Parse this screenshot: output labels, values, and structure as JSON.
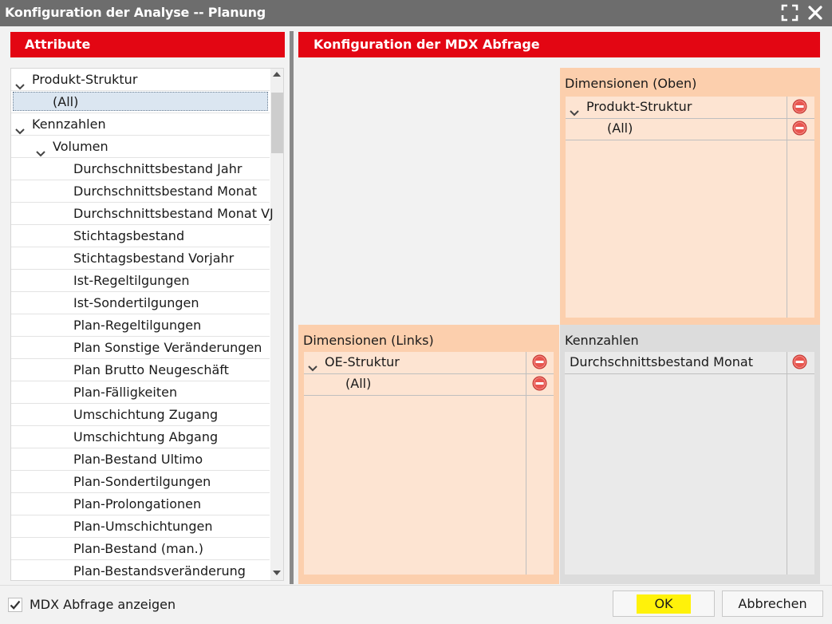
{
  "window": {
    "title": "Konfiguration der Analyse -- Planung"
  },
  "left_panel": {
    "header": "Attribute",
    "tree": [
      {
        "label": "Produkt-Struktur",
        "level": 0,
        "expanded": true
      },
      {
        "label": "(All)",
        "level": 1,
        "selected": true
      },
      {
        "label": "Kennzahlen",
        "level": 0,
        "expanded": true
      },
      {
        "label": "Volumen",
        "level": 1,
        "expanded": true
      },
      {
        "label": "Durchschnittsbestand Jahr",
        "level": 2
      },
      {
        "label": "Durchschnittsbestand Monat",
        "level": 2
      },
      {
        "label": "Durchschnittsbestand Monat VJ",
        "level": 2
      },
      {
        "label": "Stichtagsbestand",
        "level": 2
      },
      {
        "label": "Stichtagsbestand Vorjahr",
        "level": 2
      },
      {
        "label": "Ist-Regeltilgungen",
        "level": 2
      },
      {
        "label": "Ist-Sondertilgungen",
        "level": 2
      },
      {
        "label": "Plan-Regeltilgungen",
        "level": 2
      },
      {
        "label": "Plan Sonstige Veränderungen",
        "level": 2
      },
      {
        "label": "Plan Brutto Neugeschäft",
        "level": 2
      },
      {
        "label": "Plan-Fälligkeiten",
        "level": 2
      },
      {
        "label": "Umschichtung Zugang",
        "level": 2
      },
      {
        "label": "Umschichtung Abgang",
        "level": 2
      },
      {
        "label": "Plan-Bestand Ultimo",
        "level": 2
      },
      {
        "label": "Plan-Sondertilgungen",
        "level": 2
      },
      {
        "label": "Plan-Prolongationen",
        "level": 2
      },
      {
        "label": "Plan-Umschichtungen",
        "level": 2
      },
      {
        "label": "Plan-Bestand (man.)",
        "level": 2
      },
      {
        "label": "Plan-Bestandsveränderung",
        "level": 2
      }
    ]
  },
  "right_panel": {
    "header": "Konfiguration der MDX Abfrage",
    "dim_top": {
      "title": "Dimensionen (Oben)",
      "items": [
        {
          "label": "Produkt-Struktur",
          "level": 0,
          "expanded": true
        },
        {
          "label": "(All)",
          "level": 1
        }
      ]
    },
    "dim_left": {
      "title": "Dimensionen (Links)",
      "items": [
        {
          "label": "OE-Struktur",
          "level": 0,
          "expanded": true
        },
        {
          "label": "(All)",
          "level": 1
        }
      ]
    },
    "kennzahlen": {
      "title": "Kennzahlen",
      "items": [
        {
          "label": "Durchschnittsbestand Monat",
          "level": 0
        }
      ]
    }
  },
  "footer": {
    "show_mdx_label": "MDX Abfrage anzeigen",
    "show_mdx_checked": true,
    "ok_label": "OK",
    "cancel_label": "Abbrechen"
  },
  "colors": {
    "accent_red": "#e30613",
    "titlebar": "#6d6d6d",
    "dim_zone": "#fccfad",
    "dim_zone_inner": "#fde4d2",
    "kz_zone": "#dcdcdc",
    "kz_zone_inner": "#eaeaea",
    "selection": "#dbe6f1",
    "ok_highlight": "#fff20a"
  },
  "icons": {
    "remove": "minus-circle-icon",
    "expand": "chevron-down-icon",
    "maximize": "maximize-icon",
    "close": "close-icon",
    "check": "checkmark-icon"
  }
}
